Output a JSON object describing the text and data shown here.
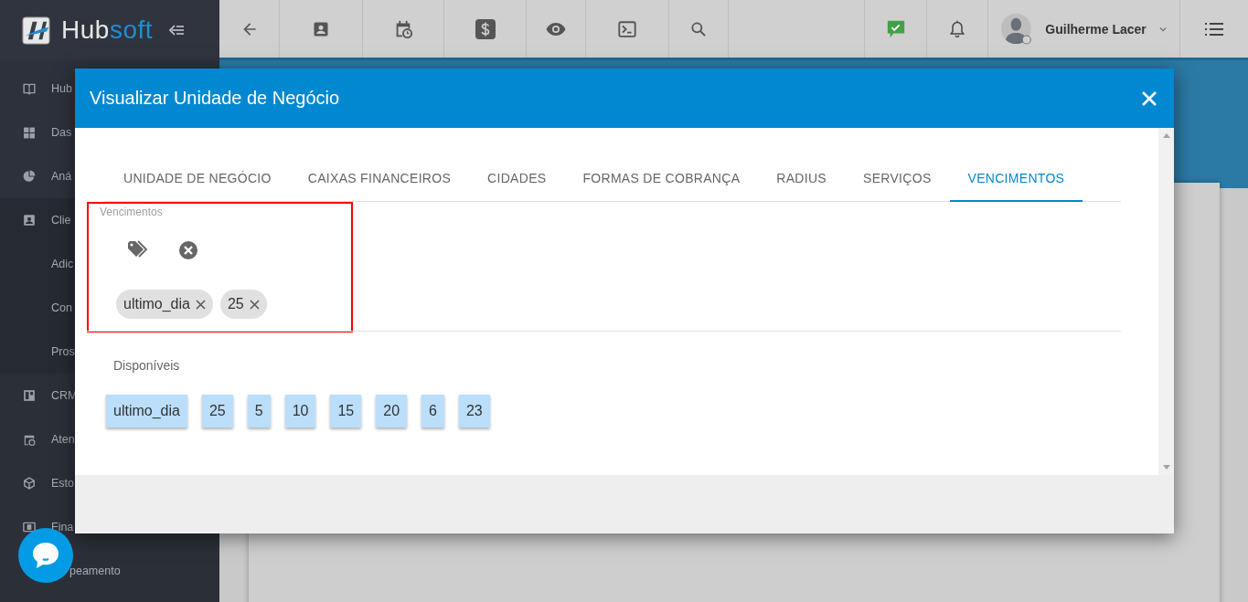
{
  "header": {
    "logo": {
      "part_1": "Hub",
      "part_2": "soft"
    },
    "toolbar": [
      {
        "kind": "back"
      },
      {
        "kind": "contact"
      },
      {
        "kind": "calendar"
      },
      {
        "kind": "dollar"
      },
      {
        "kind": "eye"
      },
      {
        "kind": "terminal"
      },
      {
        "kind": "search"
      }
    ],
    "user": {
      "name": "Guilherme Lacer"
    }
  },
  "sidebar": {
    "items": [
      {
        "label": "Hub"
      },
      {
        "label": "Das"
      },
      {
        "label": "Aná"
      },
      {
        "label": "Clie"
      },
      {
        "label": "Adic"
      },
      {
        "label": "Con"
      },
      {
        "label": "Pros"
      },
      {
        "label": "CRM"
      },
      {
        "label": "Aten"
      },
      {
        "label": "Esto"
      },
      {
        "label": "Fina"
      },
      {
        "label": "peamento"
      }
    ]
  },
  "modal": {
    "title": "Visualizar Unidade de Negócio",
    "tabs": [
      {
        "label": "UNIDADE DE NEGÓCIO",
        "selected": false
      },
      {
        "label": "CAIXAS FINANCEIROS",
        "selected": false
      },
      {
        "label": "CIDADES",
        "selected": false
      },
      {
        "label": "FORMAS DE COBRANÇA",
        "selected": false
      },
      {
        "label": "RADIUS",
        "selected": false
      },
      {
        "label": "SERVIÇOS",
        "selected": false
      },
      {
        "label": "VENCIMENTOS",
        "selected": true
      }
    ],
    "field": {
      "label": "Vencimentos",
      "highlighted": true,
      "chips": [
        "ultimo_dia",
        "25"
      ]
    },
    "available": {
      "label": "Disponíveis",
      "items": [
        "ultimo_dia",
        "25",
        "5",
        "10",
        "15",
        "20",
        "6",
        "23"
      ]
    }
  }
}
